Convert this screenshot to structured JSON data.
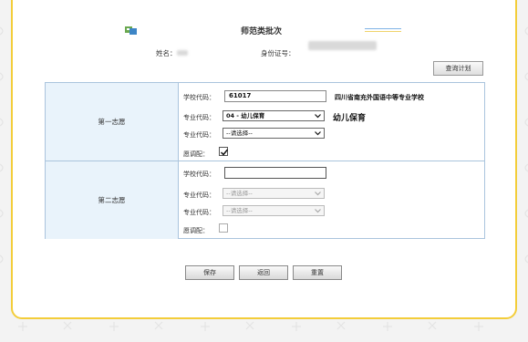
{
  "header": {
    "title": "师范类批次",
    "logo_icon": "app-logo-icon",
    "link_icon": "underline-link-icon"
  },
  "applicant": {
    "name_label": "姓名：",
    "id_label": "身份证号："
  },
  "toolbar": {
    "query_plan_label": "查询计划"
  },
  "choice1": {
    "label": "第一志愿",
    "school_code_label": "学校代码：",
    "school_code_value": "61017",
    "school_name": "四川省南充外国语中等专业学校",
    "major1_label": "专业代码：",
    "major1_value": "04 - 幼儿保育",
    "major1_name": "幼儿保育",
    "major2_label": "专业代码：",
    "major2_value": "--请选择--",
    "adjust_label": "愿调配：",
    "adjust_checked": true
  },
  "choice2": {
    "label": "第二志愿",
    "school_code_label": "学校代码：",
    "school_code_value": "",
    "major1_label": "专业代码：",
    "major1_value": "--请选择--",
    "major2_label": "专业代码：",
    "major2_value": "--请选择--",
    "adjust_label": "愿调配：",
    "adjust_checked": false
  },
  "actions": {
    "save_label": "保存",
    "back_label": "返回",
    "reset_label": "重置"
  },
  "colors": {
    "card_border": "#f3cd3a",
    "section_bg": "#e9f3fb",
    "table_border": "#aac4dd"
  }
}
